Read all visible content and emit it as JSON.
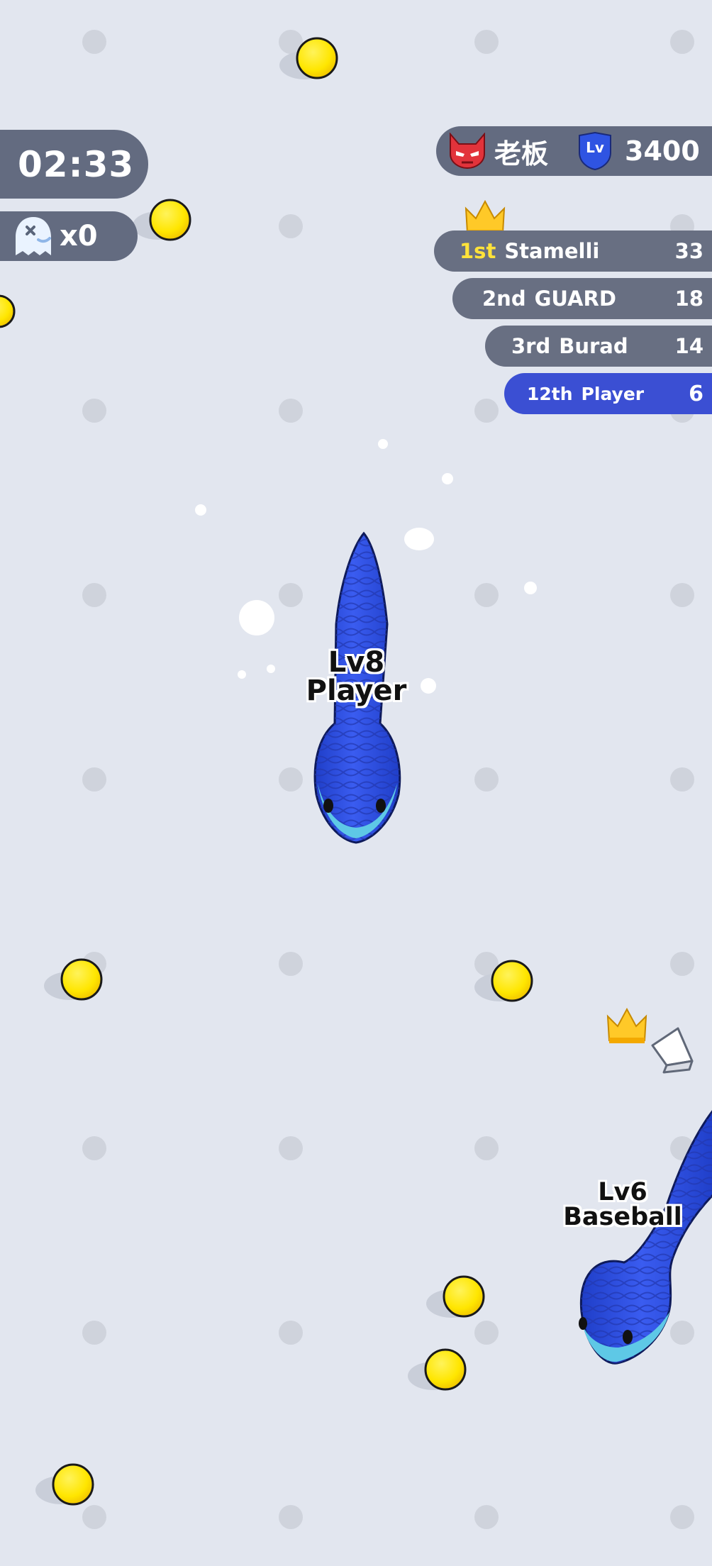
{
  "hud": {
    "timer": "02:33",
    "kills": "x0",
    "profile_name": "老板",
    "level_badge": "Lv",
    "score": "3400"
  },
  "leaderboard": [
    {
      "rank": "1st",
      "name": "Stamelli",
      "score": "33"
    },
    {
      "rank": "2nd",
      "name": "GUARD",
      "score": "18"
    },
    {
      "rank": "3rd",
      "name": "Burad",
      "score": "14"
    },
    {
      "rank": "12th",
      "name": "Player",
      "score": "6"
    }
  ],
  "snakes": {
    "player": {
      "level": "Lv8",
      "name": "Player"
    },
    "enemy": {
      "level": "Lv6",
      "name": "Baseball"
    }
  },
  "icons": {
    "kills": "skull-ghost-icon",
    "profile": "devil-mask-icon",
    "level": "shield-icon",
    "leader": "crown-icon",
    "pointer": "arrow-pointer-icon"
  },
  "colors": {
    "background": "#e2e6ef",
    "hud_pill": "#636b80",
    "highlight_row": "#3b4fd3",
    "first_place": "#ffe23a",
    "snake_body": "#2f4fe0",
    "snake_belly": "#5ec8e6",
    "food": "#ffe600"
  }
}
